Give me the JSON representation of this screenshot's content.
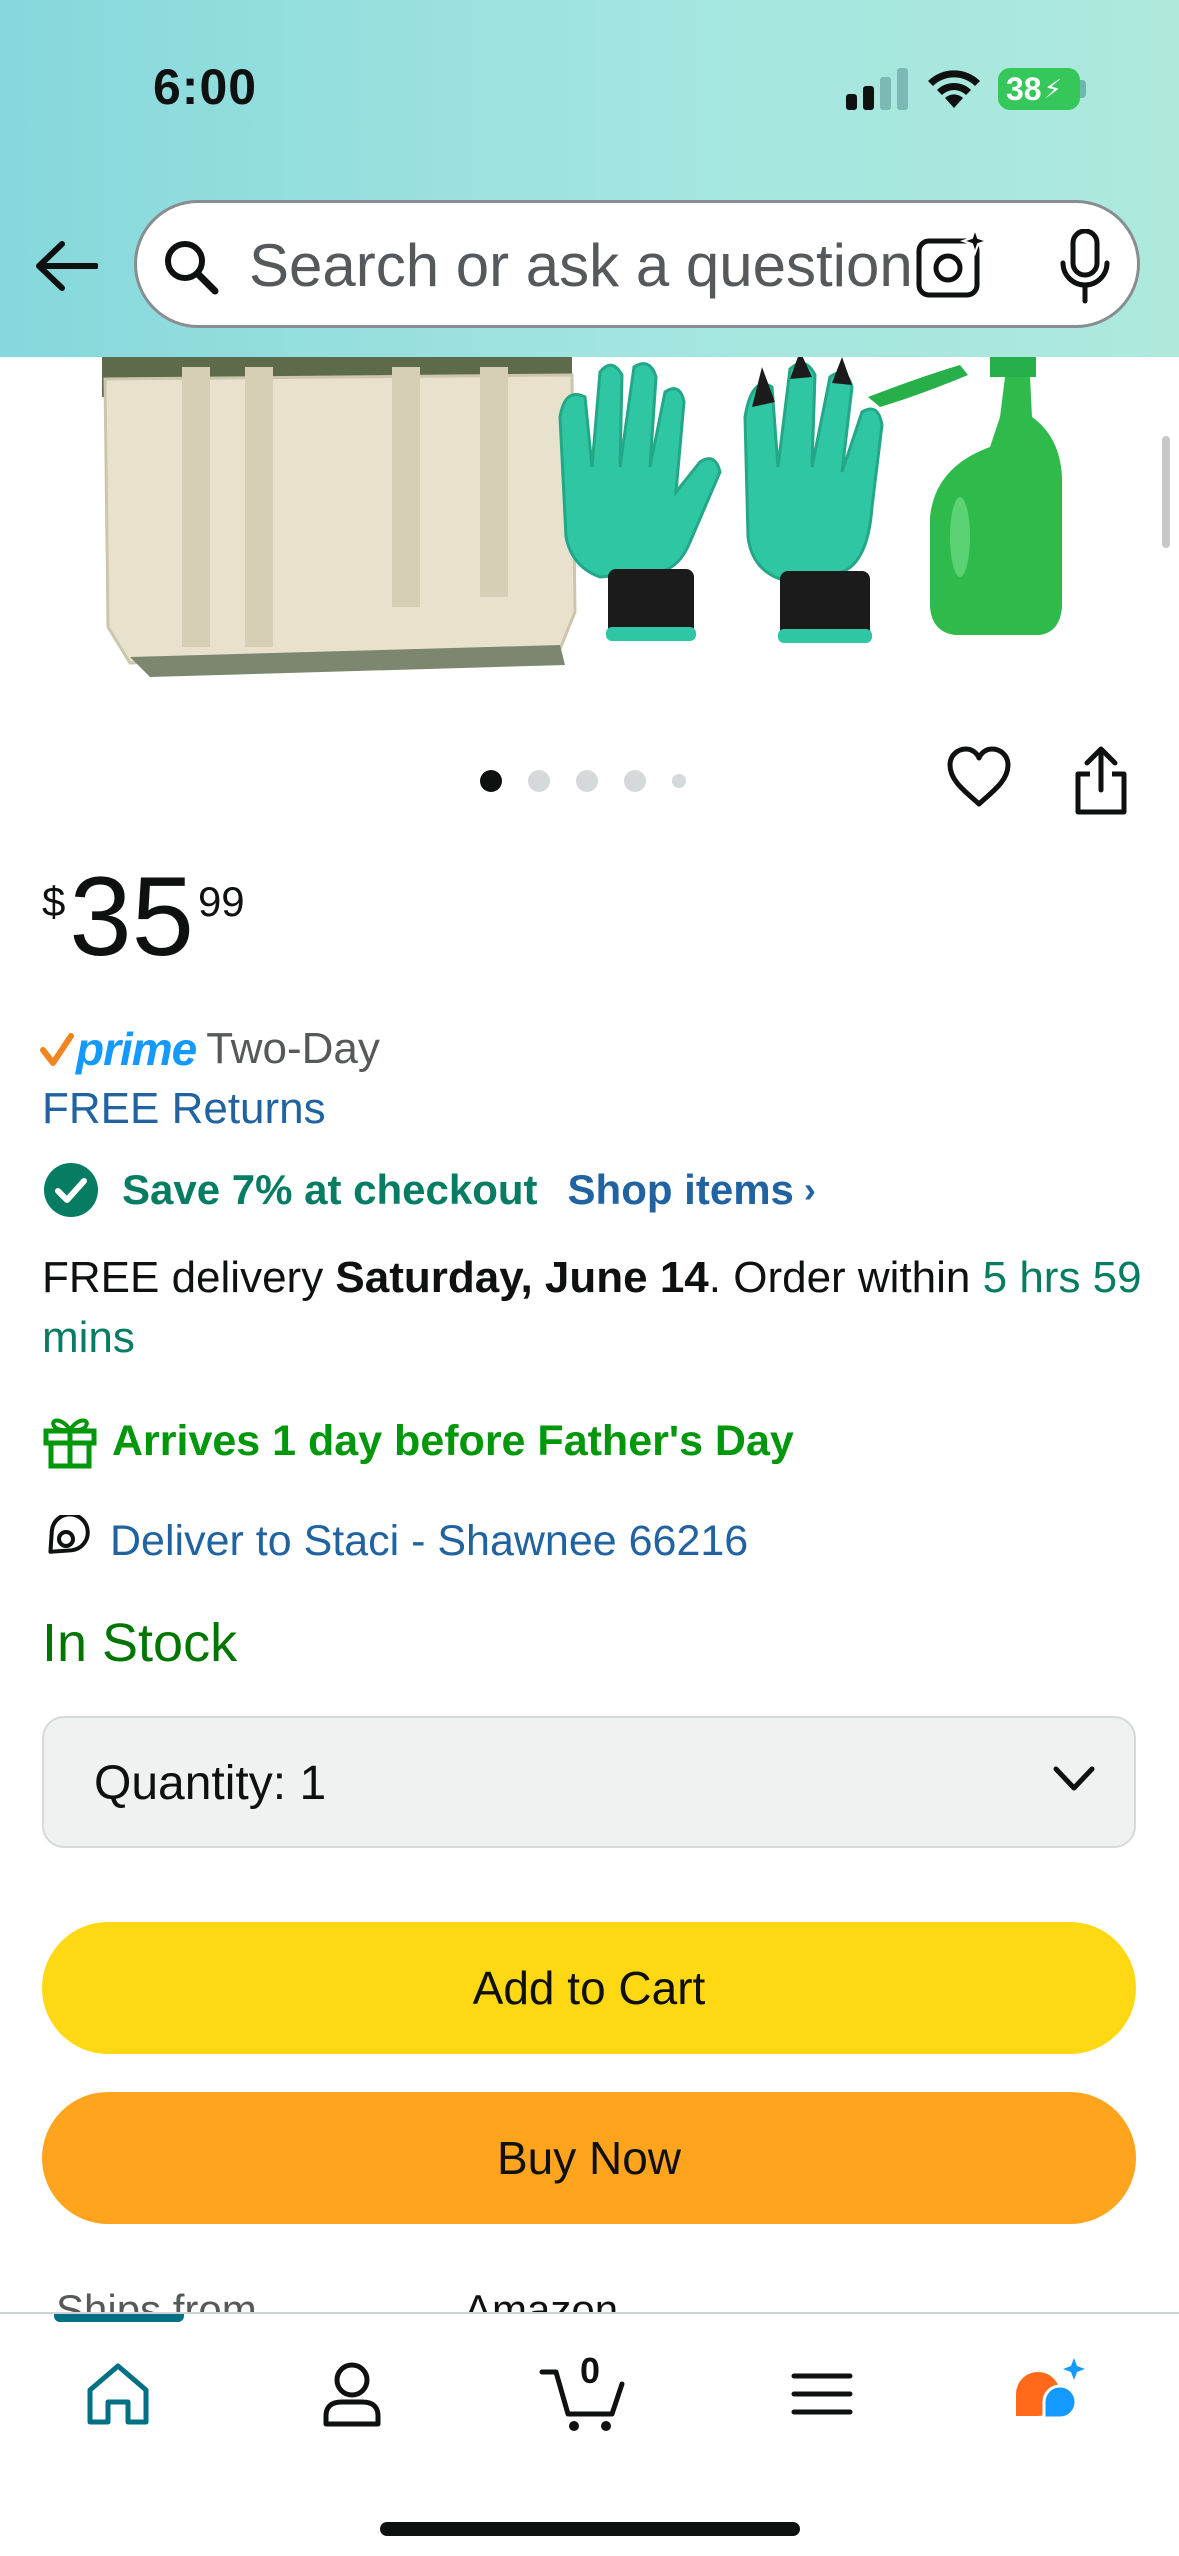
{
  "status_bar": {
    "time": "6:00",
    "battery": "38"
  },
  "search": {
    "placeholder": "Search or ask a question"
  },
  "carousel": {
    "total_images": 5,
    "current_index": 1
  },
  "price": {
    "currency": "$",
    "whole": "35",
    "fraction": "99"
  },
  "prime": {
    "logo_text": "prime",
    "label": "Two-Day"
  },
  "returns": {
    "label": "FREE Returns"
  },
  "coupon": {
    "text": "Save 7% at checkout",
    "link": "Shop items",
    "chevron": "›"
  },
  "delivery": {
    "prefix": "FREE delivery ",
    "date": "Saturday, June 14",
    "middle": ". Order within ",
    "countdown": "5 hrs 59 mins"
  },
  "gift": {
    "text": "Arrives 1 day before Father's Day"
  },
  "deliver_to": {
    "text": "Deliver to Staci - Shawnee 66216"
  },
  "stock": {
    "text": "In Stock"
  },
  "quantity": {
    "label": "Quantity:",
    "value": "1"
  },
  "buttons": {
    "add_to_cart": "Add to Cart",
    "buy_now": "Buy Now"
  },
  "ships": {
    "label": "Ships from",
    "value": "Amazon"
  },
  "nav": {
    "cart_count": "0",
    "active": "home"
  },
  "colors": {
    "header_gradient": [
      "#86d8dc",
      "#aee9dc"
    ],
    "link_blue": "#2162a1",
    "green": "#067d62",
    "add_to_cart": "#ffd814",
    "buy_now": "#ffa41c"
  },
  "icons": [
    "back-arrow-icon",
    "search-icon",
    "camera-icon",
    "mic-icon",
    "heart-icon",
    "share-icon",
    "check-circle-icon",
    "gift-icon",
    "location-pin-icon",
    "chevron-down-icon",
    "home-icon",
    "account-icon",
    "cart-icon",
    "menu-icon",
    "rufus-icon"
  ]
}
